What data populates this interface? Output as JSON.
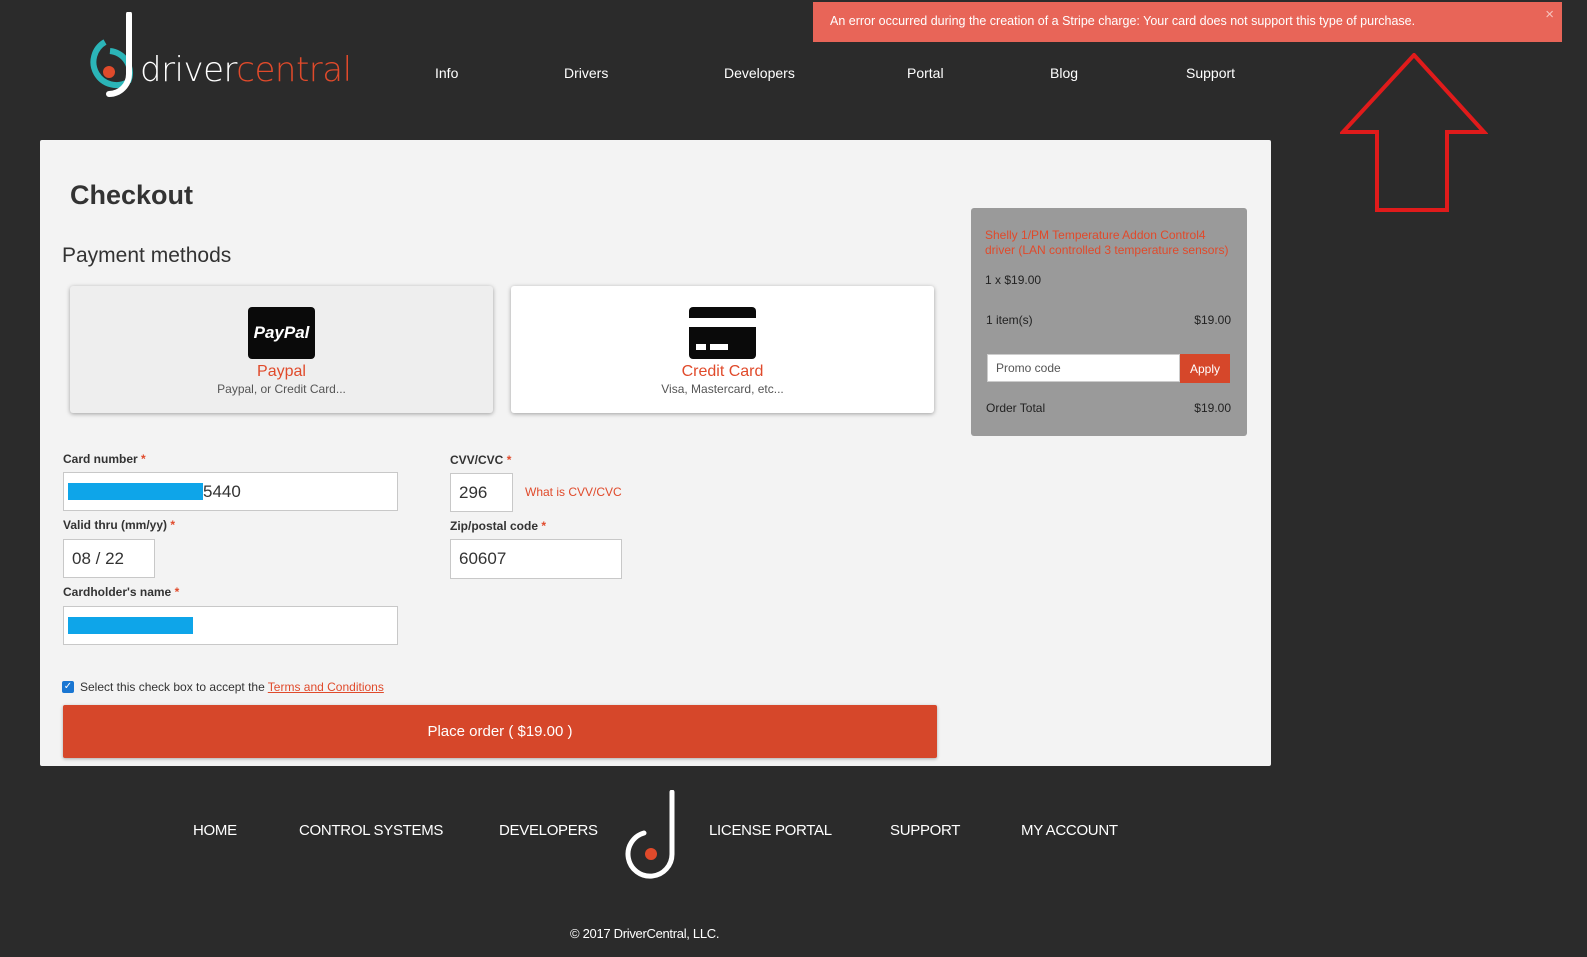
{
  "header": {
    "brand_first": "driver",
    "brand_second": "central",
    "nav": [
      "Info",
      "Drivers",
      "Developers",
      "Portal",
      "Blog",
      "Support"
    ]
  },
  "error_banner": {
    "message": "An error occurred during the creation of a Stripe charge: Your card does not support this type of purchase.",
    "close_symbol": "×"
  },
  "checkout": {
    "title": "Checkout",
    "payment_methods_title": "Payment methods",
    "methods": [
      {
        "icon_text": "PayPal",
        "name": "Paypal",
        "description": "Paypal, or Credit Card..."
      },
      {
        "name": "Credit Card",
        "description": "Visa, Mastercard, etc..."
      }
    ],
    "fields": {
      "card_number_label": "Card number",
      "card_number_value": "5440",
      "valid_thru_label": "Valid thru (mm/yy)",
      "valid_thru_value": "08 / 22",
      "cardholder_label": "Cardholder's name",
      "cvv_label": "CVV/CVC",
      "cvv_value": "296",
      "cvv_help": "What is CVV/CVC",
      "zip_label": "Zip/postal code",
      "zip_value": "60607",
      "required_mark": "*"
    },
    "terms_text": "Select this check box to accept the",
    "terms_link": "Terms and Conditions",
    "terms_checked": true,
    "place_order_label": "Place order ( $19.00 )"
  },
  "summary": {
    "product_name": "Shelly 1/PM Temperature Addon Control4 driver (LAN controlled 3 temperature sensors)",
    "quantity_line": "1 x $19.00",
    "items_label": "1 item(s)",
    "items_total": "$19.00",
    "promo_placeholder": "Promo code",
    "apply_label": "Apply",
    "order_total_label": "Order Total",
    "order_total_value": "$19.00"
  },
  "footer": {
    "nav": [
      "HOME",
      "CONTROL SYSTEMS",
      "DEVELOPERS",
      "LICENSE PORTAL",
      "SUPPORT",
      "MY ACCOUNT"
    ],
    "copyright": "© 2017 DriverCentral, LLC."
  },
  "colors": {
    "accent": "#e04a2b",
    "banner": "#e86558",
    "background": "#2b2b2b",
    "annotation": "#e01b1b"
  },
  "icons": [
    "drivercentral-logo-icon",
    "paypal-icon",
    "credit-card-icon",
    "close-icon",
    "annotation-arrow-icon"
  ]
}
